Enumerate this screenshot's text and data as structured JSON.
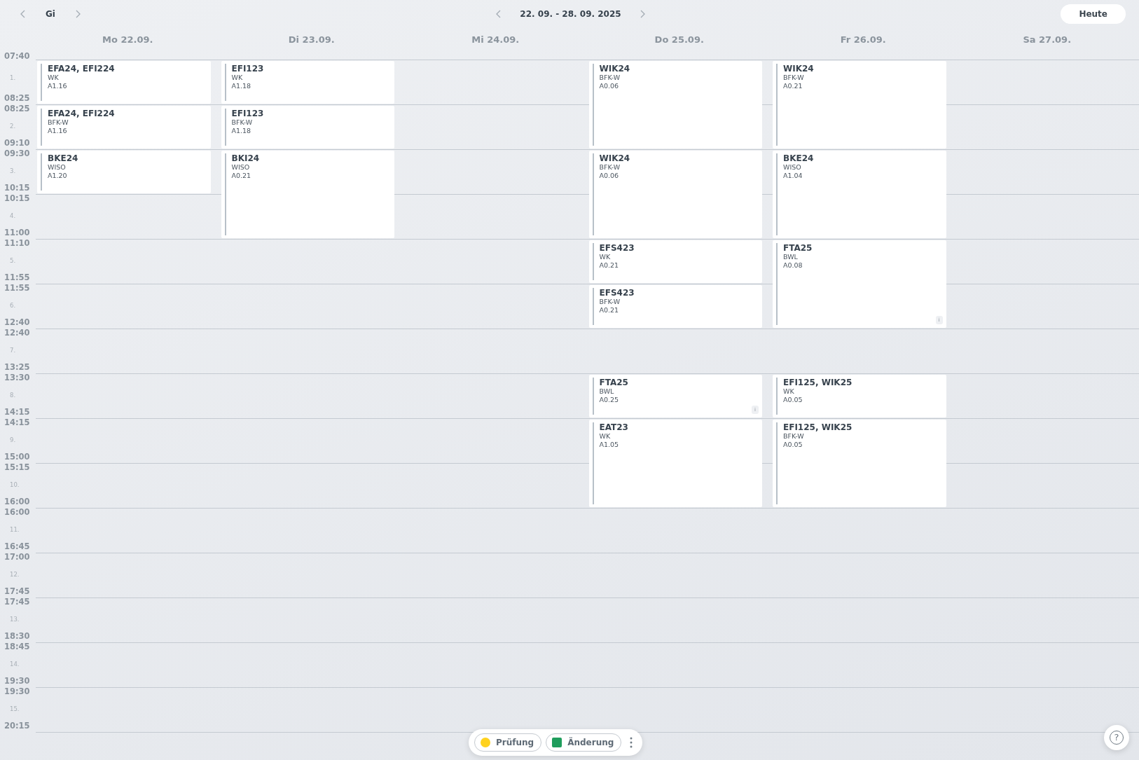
{
  "toolbar": {
    "class_label": "Gi",
    "week_range": "22. 09. - 28. 09. 2025",
    "today_button": "Heute"
  },
  "days": [
    {
      "label": "Mo 22.09.",
      "slots": [
        {
          "kind": "single",
          "title": "EFA24, EFI224",
          "subject": "WK",
          "room": "A1.16"
        },
        {
          "kind": "single",
          "title": "EFA24, EFI224",
          "subject": "BFK-W",
          "room": "A1.16"
        },
        {
          "kind": "single",
          "title": "BKE24",
          "subject": "WISO",
          "room": "A1.20"
        }
      ]
    },
    {
      "label": "Di 23.09.",
      "slots": [
        {
          "kind": "single",
          "title": "EFI123",
          "subject": "WK",
          "room": "A1.18"
        },
        {
          "kind": "single",
          "title": "EFI123",
          "subject": "BFK-W",
          "room": "A1.18"
        },
        {
          "kind": "double",
          "title": "BKI24",
          "subject": "WISO",
          "room": "A0.21"
        }
      ]
    },
    {
      "label": "Mi 24.09."
    },
    {
      "label": "Do 25.09.",
      "slots": [
        {
          "kind": "double",
          "title": "WIK24",
          "subject": "BFK-W",
          "room": "A0.06"
        },
        {
          "kind": "double",
          "title": "WIK24",
          "subject": "BFK-W",
          "room": "A0.06"
        },
        {
          "kind": "single",
          "title": "EFS423",
          "subject": "WK",
          "room": "A0.21"
        },
        {
          "kind": "single",
          "title": "EFS423",
          "subject": "BFK-W",
          "room": "A0.21"
        },
        {
          "kind": "free"
        },
        {
          "kind": "single",
          "title": "FTA25",
          "subject": "BWL",
          "room": "A0.25",
          "badge": "i"
        },
        {
          "kind": "double",
          "title": "EAT23",
          "subject": "WK",
          "room": "A1.05"
        }
      ]
    },
    {
      "label": "Fr 26.09.",
      "slots": [
        {
          "kind": "double",
          "title": "WIK24",
          "subject": "BFK-W",
          "room": "A0.21"
        },
        {
          "kind": "double",
          "title": "BKE24",
          "subject": "WISO",
          "room": "A1.04"
        },
        {
          "kind": "double",
          "title": "FTA25",
          "subject": "BWL",
          "room": "A0.08",
          "badge": "i"
        },
        {
          "kind": "free"
        },
        {
          "kind": "single",
          "title": "EFI125, WIK25",
          "subject": "WK",
          "room": "A0.05"
        },
        {
          "kind": "double",
          "title": "EFI125, WIK25",
          "subject": "BFK-W",
          "room": "A0.05"
        }
      ]
    },
    {
      "label": "Sa 27.09."
    }
  ],
  "periods": [
    {
      "number": "1.",
      "start": "07:40",
      "end": "08:25"
    },
    {
      "number": "2.",
      "start": "08:25",
      "end": "09:10"
    },
    {
      "number": "3.",
      "start": "09:30",
      "end": "10:15"
    },
    {
      "number": "4.",
      "start": "10:15",
      "end": "11:00"
    },
    {
      "number": "5.",
      "start": "11:10",
      "end": "11:55"
    },
    {
      "number": "6.",
      "start": "11:55",
      "end": "12:40"
    },
    {
      "number": "7.",
      "start": "12:40",
      "end": "13:25"
    },
    {
      "number": "8.",
      "start": "13:30",
      "end": "14:15"
    },
    {
      "number": "9.",
      "start": "14:15",
      "end": "15:00"
    },
    {
      "number": "10.",
      "start": "15:15",
      "end": "16:00"
    },
    {
      "number": "11.",
      "start": "16:00",
      "end": "16:45"
    },
    {
      "number": "12.",
      "start": "17:00",
      "end": "17:45"
    },
    {
      "number": "13.",
      "start": "17:45",
      "end": "18:30"
    },
    {
      "number": "14.",
      "start": "18:45",
      "end": "19:30"
    },
    {
      "number": "15.",
      "start": "19:30",
      "end": "20:15"
    }
  ],
  "legend": [
    {
      "label": "Prüfung",
      "kind": "circle",
      "color": "#ffd21f"
    },
    {
      "label": "Änderung",
      "kind": "square",
      "color": "#1f9d5c"
    }
  ],
  "help_button": "?"
}
